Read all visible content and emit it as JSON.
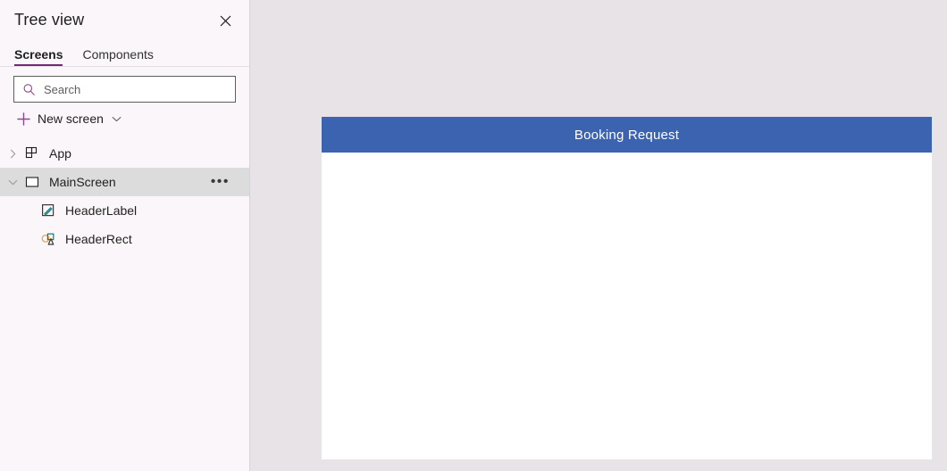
{
  "panel": {
    "title": "Tree view",
    "close_icon": "close-icon",
    "tabs": [
      {
        "label": "Screens",
        "active": true
      },
      {
        "label": "Components",
        "active": false
      }
    ],
    "search": {
      "icon": "search-icon",
      "placeholder": "Search",
      "value": ""
    },
    "new_screen": {
      "plus_icon": "plus-icon",
      "label": "New screen",
      "chevron_icon": "chevron-down-icon"
    },
    "tree": [
      {
        "label": "App",
        "icon": "app-grid-icon",
        "twisty": "chevron-right-icon",
        "depth": 0,
        "selected": false,
        "more": ""
      },
      {
        "label": "MainScreen",
        "icon": "screen-rectangle-icon",
        "twisty": "chevron-down-icon",
        "depth": 0,
        "selected": true,
        "more": "•••"
      },
      {
        "label": "HeaderLabel",
        "icon": "label-pencil-icon",
        "twisty": "",
        "depth": 1,
        "selected": false,
        "more": ""
      },
      {
        "label": "HeaderRect",
        "icon": "shapes-icon",
        "twisty": "",
        "depth": 1,
        "selected": false,
        "more": ""
      }
    ]
  },
  "canvas": {
    "background_color": "#e7e3e6",
    "screen_background": "#ffffff",
    "header_rect": {
      "name": "HeaderRect",
      "fill": "#3b63b0"
    },
    "header_label": {
      "name": "HeaderLabel",
      "text": "Booking Request",
      "color": "#ffffff"
    }
  },
  "theme": {
    "accent": "#742774",
    "panel_background": "#faf6f9",
    "selection": "#dcdcdc"
  }
}
